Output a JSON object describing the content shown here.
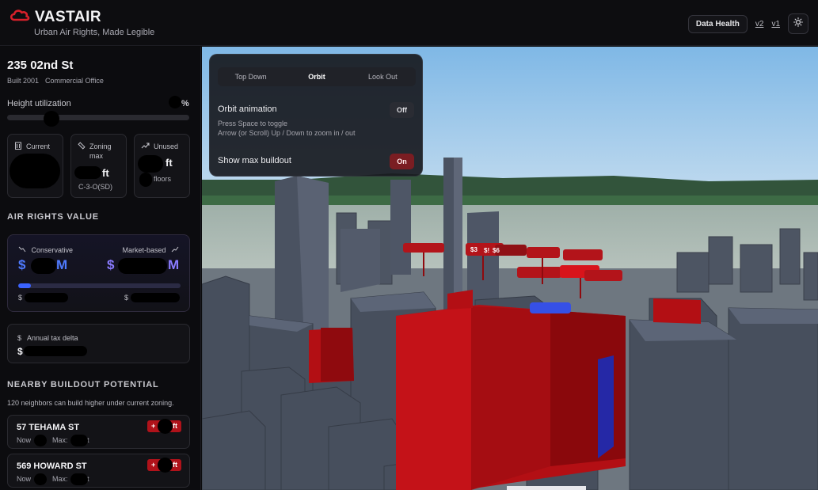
{
  "header": {
    "brand": "VASTAIR",
    "tagline": "Urban Air Rights, Made Legible",
    "data_health_label": "Data Health",
    "version_links": [
      "v2",
      "v1"
    ],
    "accent_color": "#d6202a"
  },
  "property": {
    "address": "235 02nd St",
    "built": "Built 2001",
    "use": "Commercial Office",
    "height_utilization_label": "Height utilization",
    "height_utilization_unit": "%",
    "height_utilization_value": null
  },
  "stats": {
    "current_label": "Current",
    "zoning_label_1": "Zoning",
    "zoning_label_2": "max",
    "zoning_unit": "ft",
    "zoning_code": "C-3-O(SD)",
    "unused_label": "Unused",
    "unused_unit": "ft",
    "unused_floors_label": "floors"
  },
  "air_rights": {
    "section_title": "AIR RIGHTS VALUE",
    "conservative_label": "Conservative",
    "market_label": "Market-based",
    "currency": "$",
    "suffix": "M",
    "small_currency": "$",
    "bar_fill_fraction": 0.08,
    "accent_color": "#4f6bff"
  },
  "tax": {
    "label": "Annual tax delta",
    "currency": "$"
  },
  "nearby": {
    "section_title": "NEARBY BUILDOUT POTENTIAL",
    "description": "120 neighbors can build higher under current zoning.",
    "items": [
      {
        "name": "57 TEHAMA ST",
        "now_label": "Now",
        "max_label": "Max:",
        "unit": "ft",
        "badge_plus": "+",
        "badge_unit": "ft"
      },
      {
        "name": "569 HOWARD ST",
        "now_label": "Now",
        "max_label": "Max:",
        "unit": "ft",
        "badge_plus": "+",
        "badge_unit": "ft"
      }
    ]
  },
  "controls": {
    "view_modes": [
      "Top Down",
      "Orbit",
      "Look Out"
    ],
    "active_mode": "Orbit",
    "orbit_label": "Orbit animation",
    "orbit_state": "Off",
    "orbit_hint_1": "Press Space to toggle",
    "orbit_hint_2": "Arrow (or Scroll) Up / Down to zoom in / out",
    "buildout_label": "Show max buildout",
    "buildout_state": "On"
  },
  "map_labels": [
    "$3",
    "$!",
    "$6"
  ]
}
